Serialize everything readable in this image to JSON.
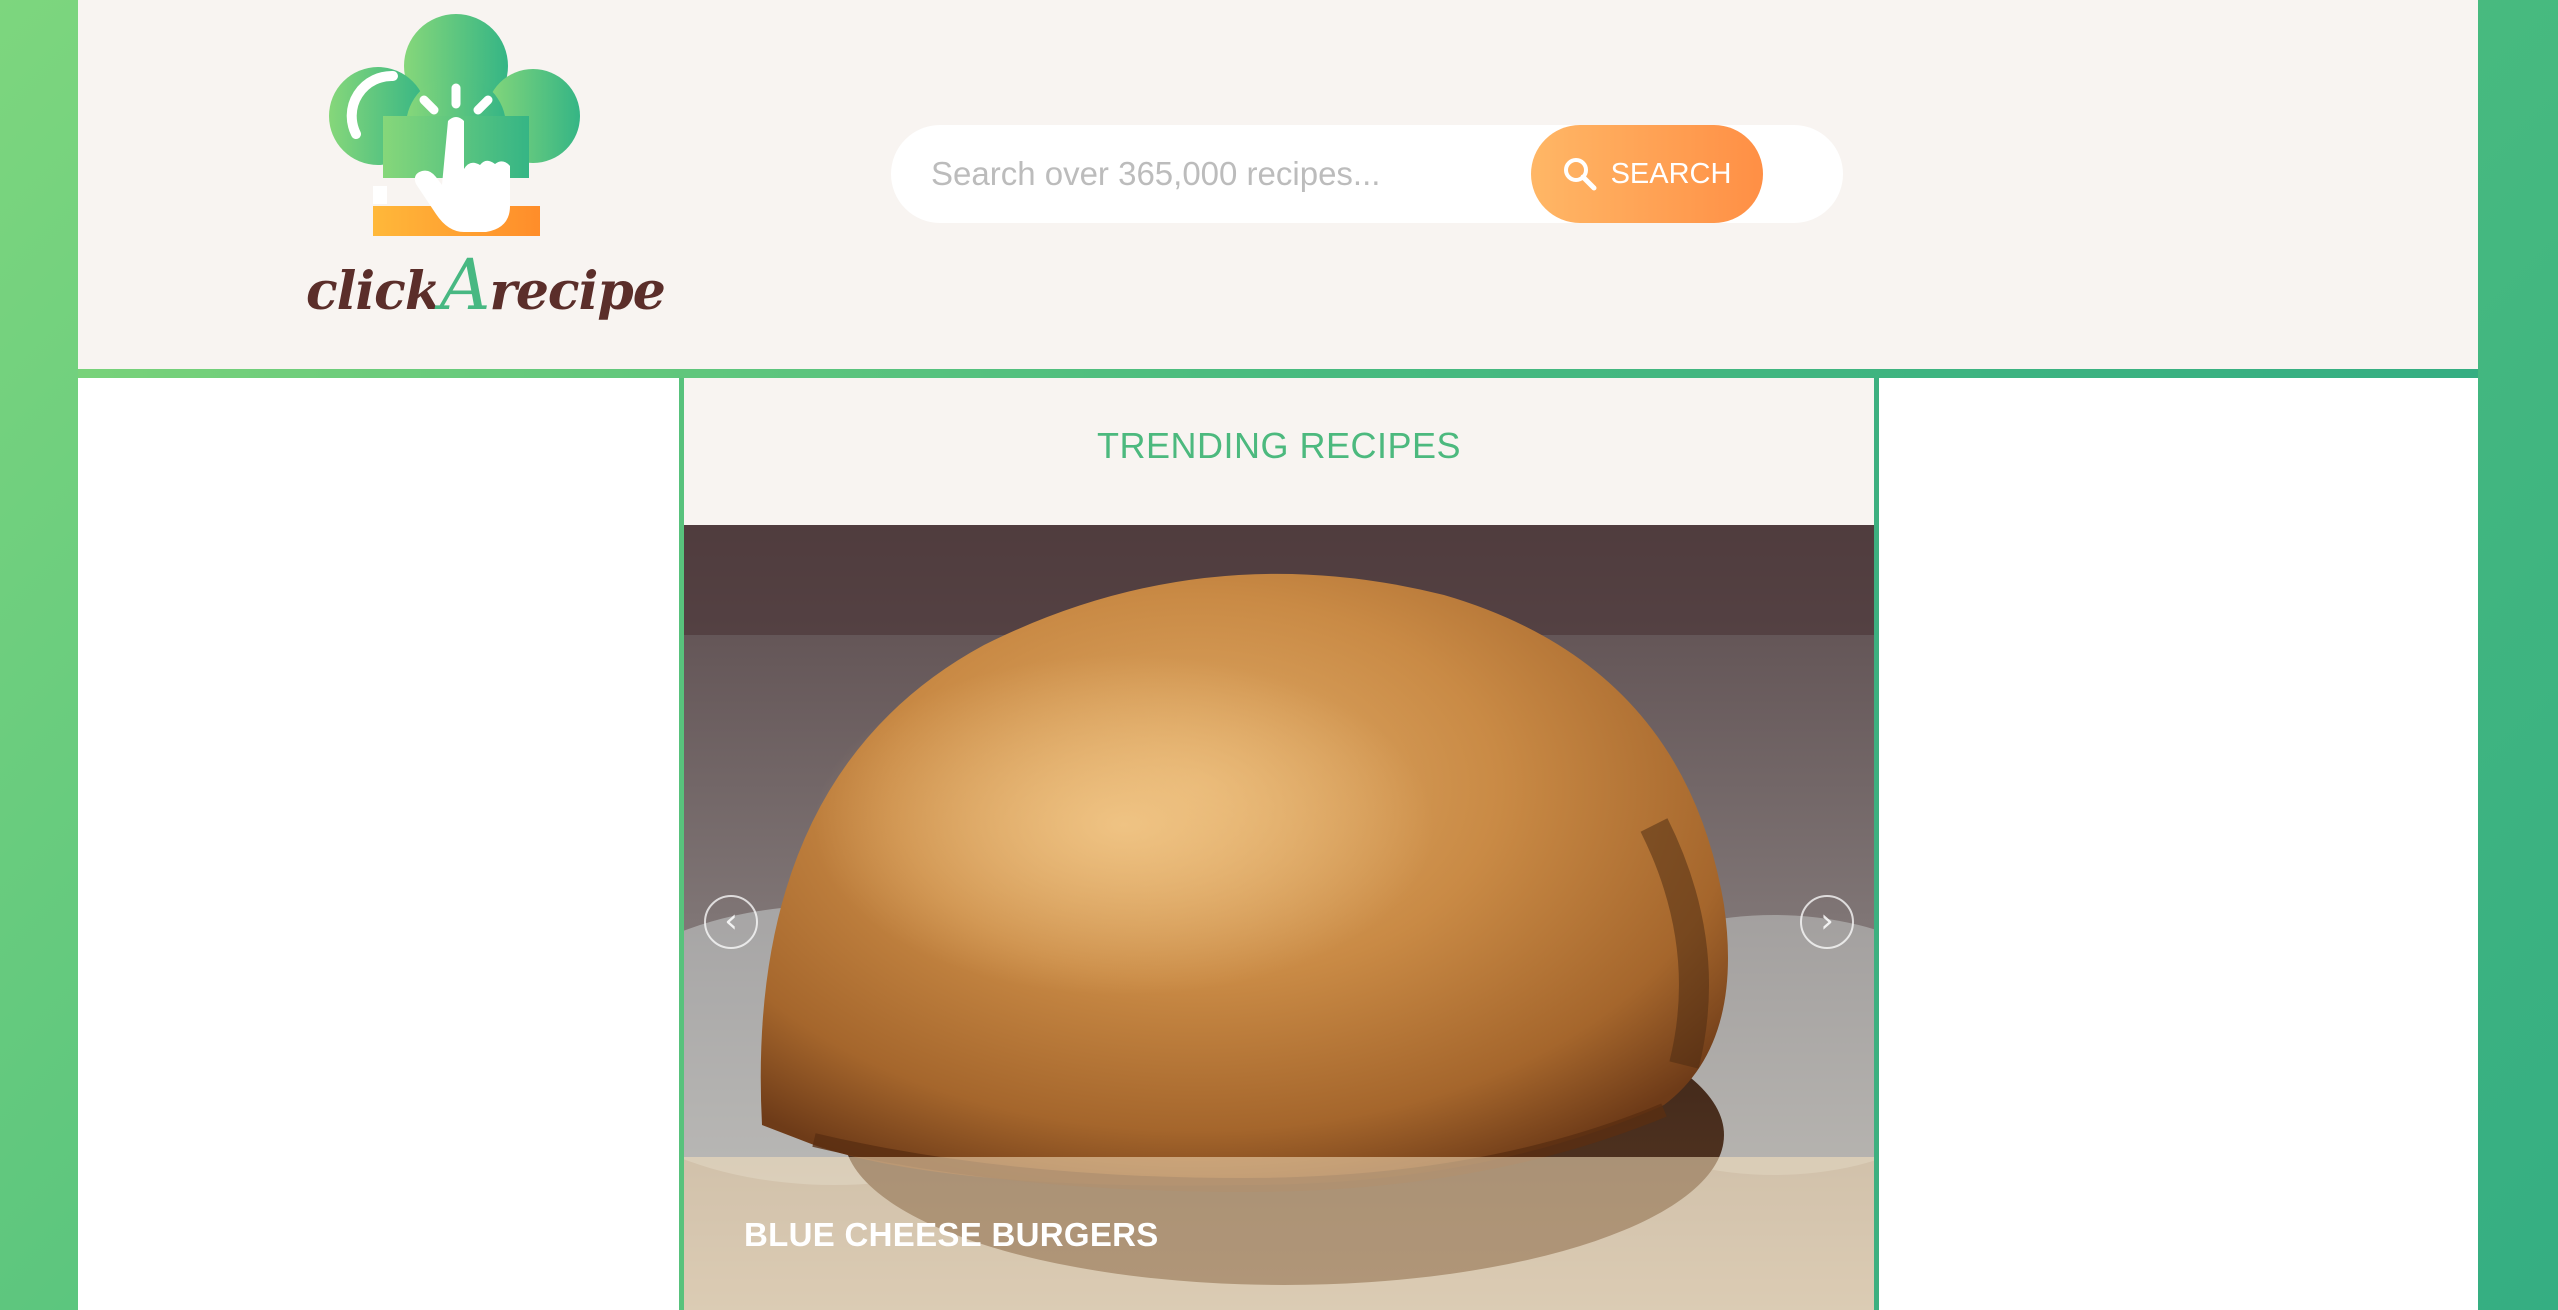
{
  "brand": {
    "logo_text_part1": "click",
    "logo_text_accent": "A",
    "logo_text_part2": "recipe",
    "logo_icon": "chef-hat-pointer-icon",
    "colors": {
      "green_light": "#7dd67e",
      "green_dark": "#35ae82",
      "orange": "#ff8f45",
      "brown": "#5b2e2a",
      "header_bg": "#f8f4f1"
    }
  },
  "search": {
    "placeholder": "Search over 365,000 recipes...",
    "value": "",
    "button_label": "SEARCH",
    "button_icon": "search-icon"
  },
  "trending": {
    "title": "TRENDING RECIPES",
    "prev_icon": "chevron-left-icon",
    "next_icon": "chevron-right-icon",
    "slides": [
      {
        "title": "BLUE CHEESE BURGERS"
      }
    ]
  }
}
